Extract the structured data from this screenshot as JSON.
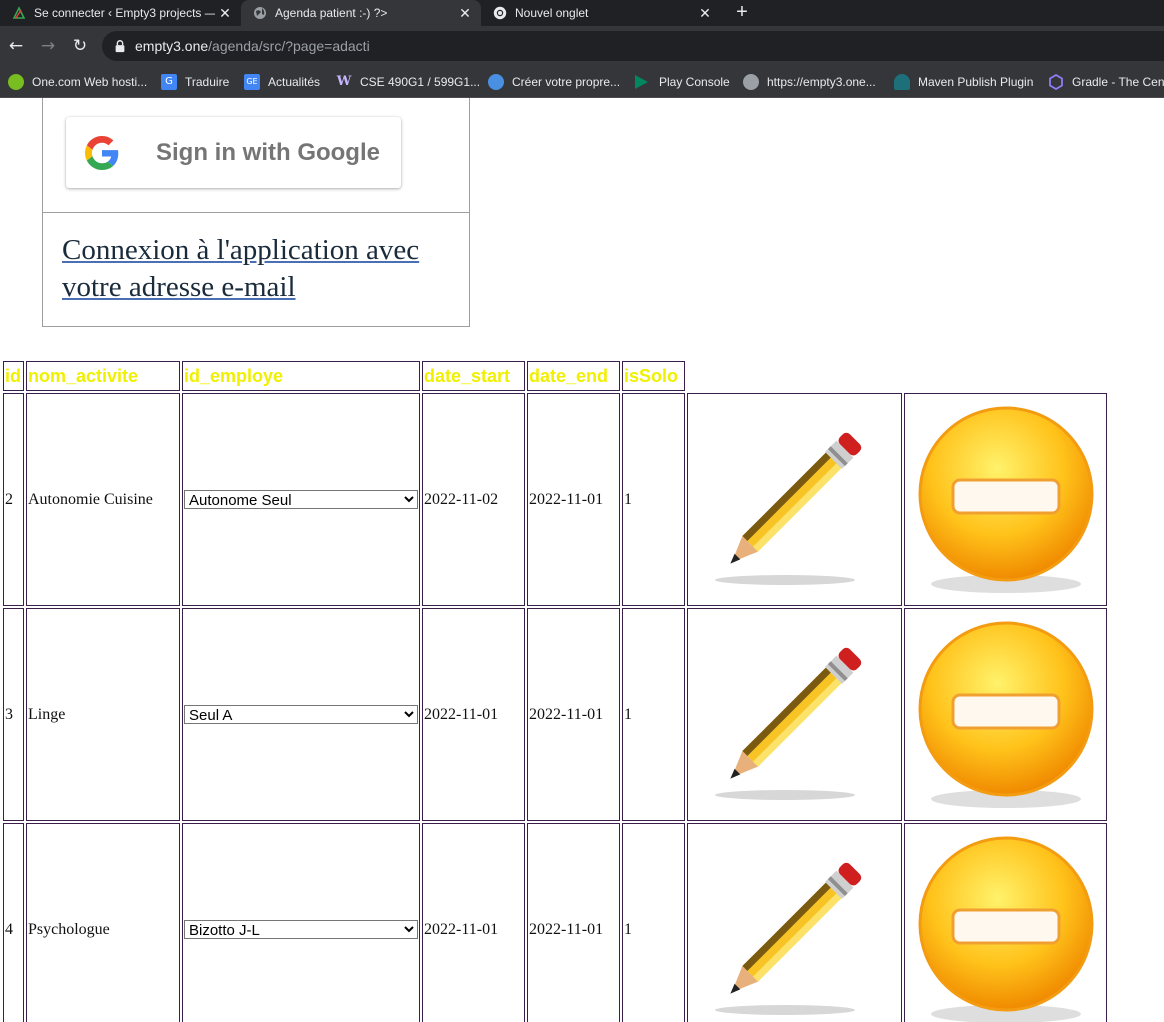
{
  "browser": {
    "tabs": [
      {
        "title": "Se connecter ‹ Empty3 projects —",
        "icon": "empty3-favicon",
        "active": false
      },
      {
        "title": "Agenda patient :-) ?>",
        "icon": "globe-icon",
        "active": true
      },
      {
        "title": "Nouvel onglet",
        "icon": "chrome-icon",
        "active": false
      }
    ],
    "close_glyph": "✕",
    "new_tab_glyph": "+",
    "url_host": "empty3.one",
    "url_path": "/agenda/src/?page=adacti",
    "bookmarks": [
      {
        "label": "One.com Web hosti...",
        "icon": "onecom-icon",
        "color": "#78be20"
      },
      {
        "label": "Traduire",
        "icon": "translate-icon",
        "color": "#4285f4"
      },
      {
        "label": "Actualités",
        "icon": "google-news-icon",
        "color": "#4285f4"
      },
      {
        "label": "CSE 490G1 / 599G1...",
        "icon": "uw-icon",
        "color": "#4b2e83"
      },
      {
        "label": "Créer votre propre...",
        "icon": "wix-icon",
        "color": "#4a90e2"
      },
      {
        "label": "Play Console",
        "icon": "play-console-icon",
        "color": "#01875f"
      },
      {
        "label": "https://empty3.one...",
        "icon": "globe-icon",
        "color": "#9aa0a6"
      },
      {
        "label": "Maven Publish Plugin",
        "icon": "gradle-elephant-icon",
        "color": "#02303a"
      },
      {
        "label": "Gradle - The Cent",
        "icon": "hexagon-icon",
        "color": "#7c6ff0"
      }
    ]
  },
  "login": {
    "google_button_label": "Sign in with Google",
    "email_link_text": "Connexion à l'application avec votre adresse e-mail"
  },
  "table": {
    "headers": [
      "id",
      "nom_activite",
      "id_employe",
      "date_start",
      "date_end",
      "isSolo"
    ],
    "rows": [
      {
        "id": "2",
        "nom_activite": "Autonomie Cuisine",
        "id_employe": "Autonome Seul",
        "date_start": "2022-11-02",
        "date_end": "2022-11-01",
        "isSolo": "1"
      },
      {
        "id": "3",
        "nom_activite": "Linge",
        "id_employe": "Seul A",
        "date_start": "2022-11-01",
        "date_end": "2022-11-01",
        "isSolo": "1"
      },
      {
        "id": "4",
        "nom_activite": "Psychologue",
        "id_employe": "Bizotto J-L",
        "date_start": "2022-11-01",
        "date_end": "2022-11-01",
        "isSolo": "1"
      }
    ],
    "edit_icon": "pencil-icon",
    "delete_icon": "minus-circle-icon"
  },
  "colors": {
    "header_text": "#f0f000",
    "cell_border": "#3b1f4a",
    "chrome_dark": "#202124",
    "chrome_toolbar": "#35363a"
  }
}
